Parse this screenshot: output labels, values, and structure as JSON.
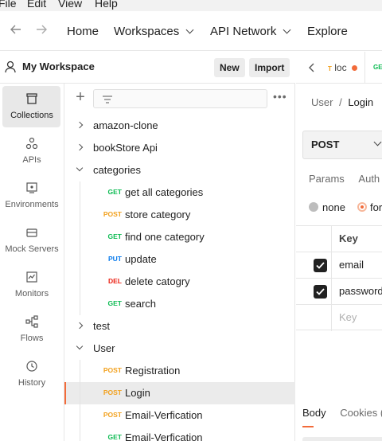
{
  "menu": {
    "file": "File",
    "edit": "Edit",
    "view": "View",
    "help": "Help"
  },
  "topnav": {
    "home": "Home",
    "workspaces": "Workspaces",
    "api_network": "API Network",
    "explore": "Explore"
  },
  "workspace": {
    "title": "My Workspace",
    "new_label": "New",
    "import_label": "Import"
  },
  "iconbar": [
    {
      "label": "Collections",
      "icon": "collections-icon"
    },
    {
      "label": "APIs",
      "icon": "apis-icon"
    },
    {
      "label": "Environments",
      "icon": "environments-icon"
    },
    {
      "label": "Mock Servers",
      "icon": "mock-servers-icon"
    },
    {
      "label": "Monitors",
      "icon": "monitors-icon"
    },
    {
      "label": "Flows",
      "icon": "flows-icon"
    },
    {
      "label": "History",
      "icon": "history-icon"
    }
  ],
  "tree": [
    {
      "type": "collection",
      "name": "amazon-clone",
      "expanded": false
    },
    {
      "type": "collection",
      "name": "bookStore Api",
      "expanded": false
    },
    {
      "type": "folder",
      "name": "categories",
      "expanded": true
    },
    {
      "type": "request",
      "method": "GET",
      "name": "get all categories"
    },
    {
      "type": "request",
      "method": "POST",
      "name": "store category"
    },
    {
      "type": "request",
      "method": "GET",
      "name": "find one category"
    },
    {
      "type": "request",
      "method": "PUT",
      "name": "update"
    },
    {
      "type": "request",
      "method": "DEL",
      "name": "delete catogry"
    },
    {
      "type": "request",
      "method": "GET",
      "name": "search"
    },
    {
      "type": "collection",
      "name": "test",
      "expanded": false
    },
    {
      "type": "folder",
      "name": "User",
      "expanded": true
    },
    {
      "type": "request",
      "method": "POST",
      "name": "Registration"
    },
    {
      "type": "request",
      "method": "POST",
      "name": "Login",
      "selected": true
    },
    {
      "type": "request",
      "method": "POST",
      "name": "Email-Verfication"
    },
    {
      "type": "request",
      "method": "GET",
      "name": "Email-Verfication"
    }
  ],
  "method_colors": {
    "GET": "#0cbb52",
    "POST": "#f2a11e",
    "PUT": "#097bed",
    "DEL": "#eb2013"
  },
  "request": {
    "tab_method": "T",
    "tab_name": "loc",
    "tab_next": "GE",
    "breadcrumb_parent": "User",
    "breadcrumb_sep": "/",
    "breadcrumb_current": "Login",
    "method": "POST",
    "tab_params": "Params",
    "tab_auth": "Auth",
    "body_none": "none",
    "body_form": "for",
    "kv_header": "Key",
    "kv_rows": [
      {
        "key": "email",
        "checked": true
      },
      {
        "key": "password",
        "checked": true
      }
    ],
    "kv_placeholder": "Key",
    "resp_body": "Body",
    "resp_cookies": "Cookies (",
    "accent": "#f26b3a"
  }
}
